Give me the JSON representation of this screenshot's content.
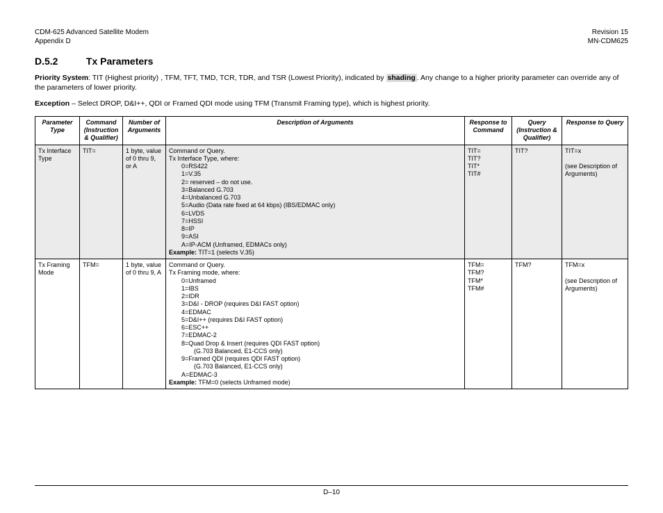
{
  "header": {
    "product": "CDM-625 Advanced Satellite Modem",
    "appendix": "Appendix D",
    "revision": "Revision 15",
    "docnum": "MN-CDM625"
  },
  "section": {
    "number": "D.5.2",
    "title": "Tx Parameters"
  },
  "intro": {
    "priority_label": "Priority System",
    "priority_body_1": ": TIT (Highest priority) , TFM, TFT, TMD, TCR, TDR, and TSR (Lowest Priority), indicated by ",
    "shading_word": "shading",
    "priority_body_2": ". Any change to a higher priority parameter can override any of the parameters of lower priority.",
    "exception_label": "Exception",
    "exception_body": " – Select DROP, D&I++, QDI or Framed QDI mode using TFM (Transmit Framing type),  which is highest priority."
  },
  "table": {
    "headers": {
      "h1": "Parameter Type",
      "h2": "Command (Instruction & Qualifier)",
      "h3": "Number of Arguments",
      "h4": "Description of Arguments",
      "h5": "Response to Command",
      "h6": "Query (Instruction & Qualifier)",
      "h7": "Response to Query"
    },
    "rows": [
      {
        "shaded": true,
        "param": "Tx Interface Type",
        "cmd": "TIT=",
        "num_args": "1 byte, value of  0 thru 9, or A",
        "desc": [
          {
            "t": "Command or Query."
          },
          {
            "t": "Tx Interface Type, where:"
          },
          {
            "t": "0=RS422",
            "i": 1
          },
          {
            "t": "1=V.35",
            "i": 1
          },
          {
            "t": "2=  reserved – do not use.",
            "i": 1
          },
          {
            "t": "3=Balanced G.703",
            "i": 1
          },
          {
            "t": "4=Unbalanced G.703",
            "i": 1
          },
          {
            "t": "5=Audio (Data rate fixed at 64 kbps) (IBS/EDMAC only)",
            "i": 1
          },
          {
            "t": "6=LVDS",
            "i": 1
          },
          {
            "t": "7=HSSI",
            "i": 1
          },
          {
            "t": "8=IP",
            "i": 1
          },
          {
            "t": "9=ASI",
            "i": 1
          },
          {
            "t": "A=IP-ACM (Unframed, EDMACs only)",
            "i": 1
          }
        ],
        "example_label": "Example:",
        "example_text": " TIT=1 (selects V.35)",
        "resp_cmd": [
          "TIT=",
          "TIT?",
          "TIT*",
          "TIT#"
        ],
        "query": "TIT?",
        "resp_query": [
          "TIT=x",
          "",
          "(see Description of Arguments)"
        ]
      },
      {
        "shaded": false,
        "param": "Tx Framing Mode",
        "cmd": "TFM=",
        "num_args": "1 byte, value of  0 thru 9, A",
        "desc": [
          {
            "t": "Command or Query."
          },
          {
            "t": "Tx Framing mode, where:"
          },
          {
            "t": "0=Unframed",
            "i": 1
          },
          {
            "t": "1=IBS",
            "i": 1
          },
          {
            "t": "2=IDR",
            "i": 1
          },
          {
            "t": "3=D&I - DROP (requires D&I FAST option)",
            "i": 1
          },
          {
            "t": "4=EDMAC",
            "i": 1
          },
          {
            "t": "5=D&I++ (requires D&I FAST option)",
            "i": 1
          },
          {
            "t": "6=ESC++",
            "i": 1
          },
          {
            "t": "7=EDMAC-2",
            "i": 1
          },
          {
            "t": "8=Quad Drop & Insert (requires QDI FAST option)",
            "i": 1
          },
          {
            "t": "(G.703 Balanced, E1-CCS only)",
            "i": 2
          },
          {
            "t": "9=Framed QDI (requires QDI FAST option)",
            "i": 1
          },
          {
            "t": "(G.703 Balanced, E1-CCS only)",
            "i": 2
          },
          {
            "t": "A=EDMAC-3",
            "i": 1
          }
        ],
        "example_label": "Example:",
        "example_text": " TFM=0 (selects Unframed mode)",
        "resp_cmd": [
          "TFM=",
          "TFM?",
          "TFM*",
          "TFM#"
        ],
        "query": "TFM?",
        "resp_query": [
          "TFM=x",
          "",
          "(see Description of Arguments)"
        ]
      }
    ]
  },
  "footer": {
    "pagenum": "D–10"
  }
}
